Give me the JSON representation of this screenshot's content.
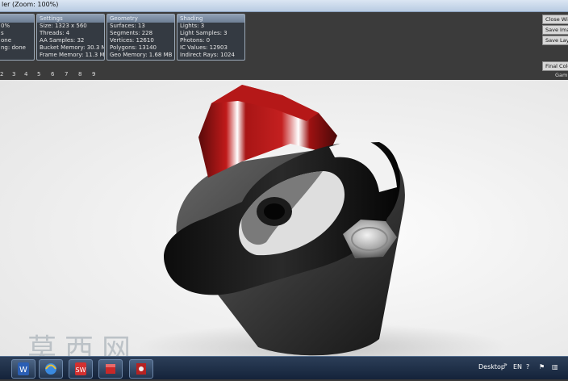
{
  "window": {
    "title": "ler (Zoom: 100%)"
  },
  "panels": {
    "partial": {
      "rows": [
        "0%",
        "s",
        "one",
        "ng: done"
      ]
    },
    "settings": {
      "header": "Settings",
      "rows": [
        "Size: 1323 x 560",
        "Threads: 4",
        "AA Samples: 32",
        "Bucket Memory: 30.3 MB",
        "Frame Memory: 11.3 MB"
      ]
    },
    "geometry": {
      "header": "Geometry",
      "rows": [
        "Surfaces: 13",
        "Segments: 228",
        "Vertices: 12610",
        "Polygons: 13140",
        "Geo Memory: 1.68 MB"
      ]
    },
    "shading": {
      "header": "Shading",
      "rows": [
        "Lights: 3",
        "Light Samples: 3",
        "Photons: 0",
        "IC Values: 12903",
        "Indirect Rays: 1024"
      ]
    }
  },
  "pager": [
    "2",
    "3",
    "4",
    "5",
    "6",
    "7",
    "8",
    "9"
  ],
  "right_buttons": {
    "close": "Close Win",
    "save_image": "Save Ima",
    "save_layers": "Save Lay",
    "final_color": "Final Colo",
    "gamma": "Gam"
  },
  "watermark": "莫西网",
  "taskbar": {
    "desktop": "Desktop",
    "chevron": "»",
    "lang": "EN",
    "apps": [
      "app-w",
      "app-ie",
      "app-solidworks",
      "app-toolbox",
      "app-tools"
    ]
  }
}
